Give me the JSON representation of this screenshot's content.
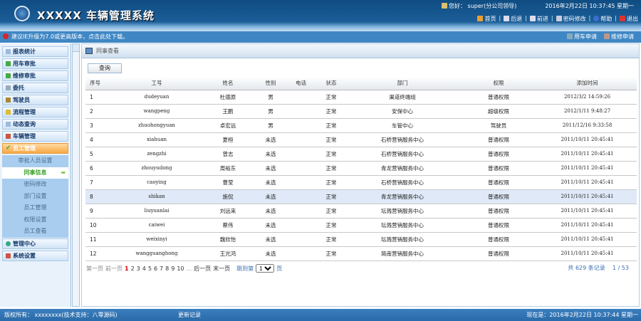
{
  "header": {
    "title": "XXXXX  车辆管理系统",
    "user": "您好： super(分公司领导)",
    "datetime": "2016年2月22日  10:37:45 星期一",
    "nav": [
      "首页",
      "后退",
      "前进",
      "密码修改",
      "帮助",
      "退出"
    ]
  },
  "notice": {
    "text": "建议IE升级为7.0或更高版本，点击此处下载。",
    "quick": [
      "用车申请",
      "维修申请"
    ]
  },
  "sidebar": {
    "menus": [
      "报表统计",
      "用车审批",
      "维修审批",
      "委托",
      "驾驶员",
      "流程管理",
      "动态查询",
      "车辆管理",
      "员工管理"
    ],
    "submenu": [
      "审批人员设置",
      "同事信息",
      "密码修改",
      "部门设置",
      "员工管理",
      "权限设置",
      "员工查看"
    ],
    "menus_after": [
      "管理中心",
      "系统设置"
    ]
  },
  "content": {
    "title": "同事查看",
    "query_button": "查询",
    "columns": [
      "序号",
      "工号",
      "姓名",
      "性别",
      "电话",
      "状态",
      "部门",
      "权限",
      "添加时间"
    ],
    "rows": [
      [
        "1",
        "dudeyuan",
        "杜德原",
        "男",
        "",
        "正常",
        "渠道终端组",
        "普通权限",
        "2012/3/2 14:59:26"
      ],
      [
        "2",
        "wangpeng",
        "王鹏",
        "男",
        "",
        "正常",
        "安保中心",
        "超级权限",
        "2012/1/11 9:48:27"
      ],
      [
        "3",
        "zhuohongyuan",
        "卓宏远",
        "男",
        "",
        "正常",
        "车管中心",
        "驾驶员",
        "2011/12/16 9:33:58"
      ],
      [
        "4",
        "xiahuan",
        "夏桓",
        "未选",
        "",
        "正常",
        "石桥营销服务中心",
        "普通权限",
        "2011/10/11 20:45:41"
      ],
      [
        "5",
        "zengzhi",
        "曾志",
        "未选",
        "",
        "正常",
        "石桥营销服务中心",
        "普通权限",
        "2011/10/11 20:45:41"
      ],
      [
        "6",
        "zhouyudong",
        "周裕东",
        "未选",
        "",
        "正常",
        "青龙营销服务中心",
        "普通权限",
        "2011/10/11 20:45:41"
      ],
      [
        "7",
        "caoying",
        "曹莹",
        "未选",
        "",
        "正常",
        "石桥营销服务中心",
        "普通权限",
        "2011/10/11 20:45:41"
      ],
      [
        "8",
        "shikan",
        "施侃",
        "未选",
        "",
        "正常",
        "青龙营销服务中心",
        "普通权限",
        "2011/10/11 20:45:41"
      ],
      [
        "9",
        "liuyuanlai",
        "刘远来",
        "未选",
        "",
        "正常",
        "坛溅营销服务中心",
        "普通权限",
        "2011/10/11 20:45:41"
      ],
      [
        "10",
        "caiwei",
        "蔡伟",
        "未选",
        "",
        "正常",
        "坛溅营销服务中心",
        "普通权限",
        "2011/10/11 20:45:41"
      ],
      [
        "11",
        "weixinyi",
        "魏欣怡",
        "未选",
        "",
        "正常",
        "坛溅营销服务中心",
        "普通权限",
        "2011/10/11 20:45:41"
      ],
      [
        "12",
        "wangguanghong",
        "王光鸿",
        "未选",
        "",
        "正常",
        "简南营销服务中心",
        "普通权限",
        "2011/10/11 20:45:41"
      ]
    ],
    "selected_row": 8,
    "pager": {
      "first": "第一页",
      "prev": "前一页",
      "pages": [
        "1",
        "2",
        "3",
        "4",
        "5",
        "6",
        "7",
        "8",
        "9",
        "10"
      ],
      "ellipsis": "...",
      "next": "后一页",
      "last": "末一页",
      "jump_label": "跳到第",
      "jump_value": "1",
      "jump_suffix": "页"
    },
    "total": "共 629 条记录",
    "page_info": "1 / 53"
  },
  "footer": {
    "copyright": "版权所有： xxxxxxxx(技术支持：八零源码)",
    "changelog": "更新记录",
    "now": "现在是：2016年2月22日 10:37:44 星期一"
  }
}
